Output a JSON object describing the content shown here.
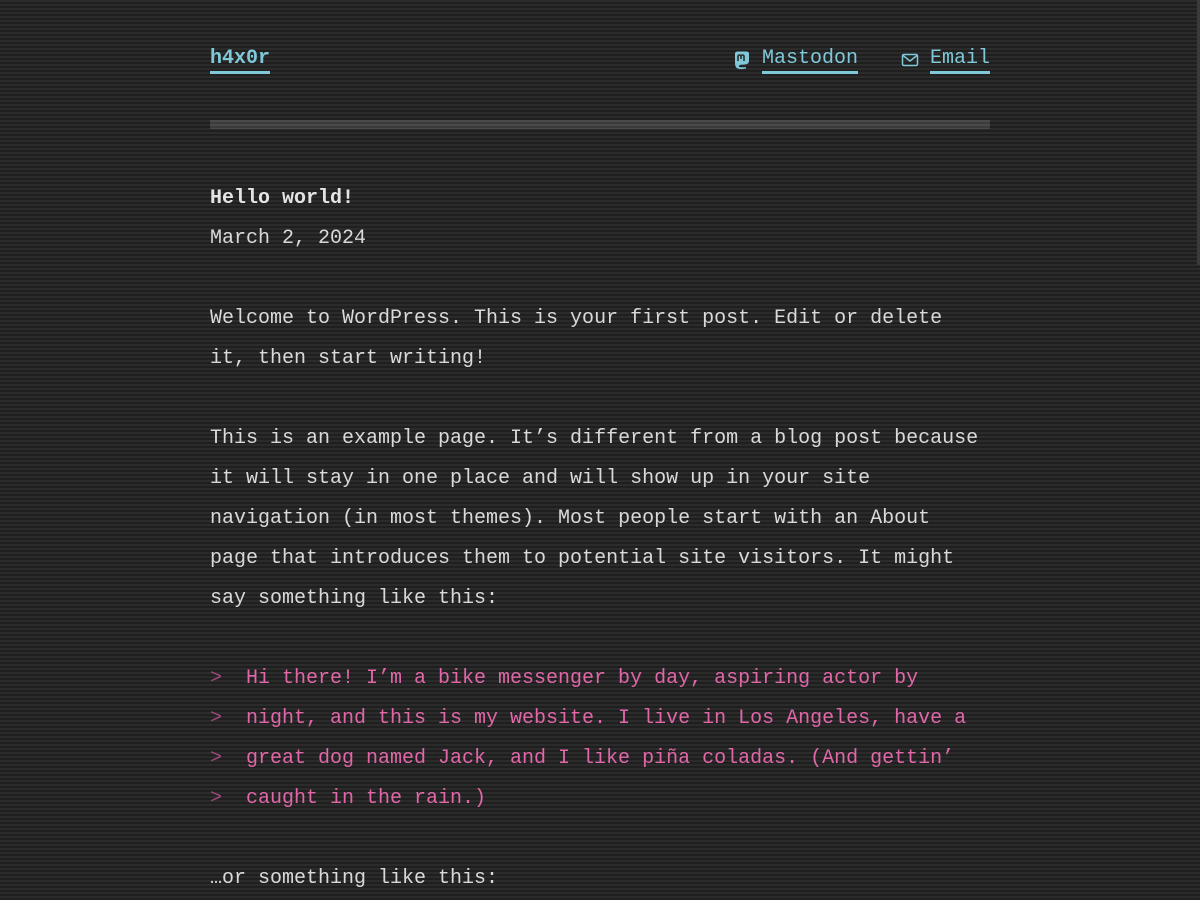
{
  "site": {
    "title": "h4x0r"
  },
  "social": [
    {
      "icon": "mastodon-icon",
      "label": "Mastodon"
    },
    {
      "icon": "envelope-icon",
      "label": "Email"
    }
  ],
  "post": {
    "title": "Hello world!",
    "date": "March 2, 2024",
    "paragraphs": [
      "Welcome to WordPress. This is your first post. Edit or delete it, then start writing!",
      "This is an example page. It’s different from a blog post because it will stay in one place and will show up in your site navigation (in most themes). Most people start with an About page that introduces them to potential site visitors. It might say something like this:"
    ],
    "quote": {
      "marker": ">",
      "lines": [
        "Hi there! I’m a bike messenger by day, aspiring actor by",
        "night, and this is my website. I live in Los Angeles, have a",
        "great dog named Jack, and I like piña coladas. (And gettin’",
        "caught in the rain.)"
      ]
    },
    "after_quote": "…or something like this:"
  },
  "colors": {
    "background": "#2b2b2c",
    "text": "#d9d9d9",
    "link": "#7ec8d8",
    "quote": "#e067a8"
  }
}
